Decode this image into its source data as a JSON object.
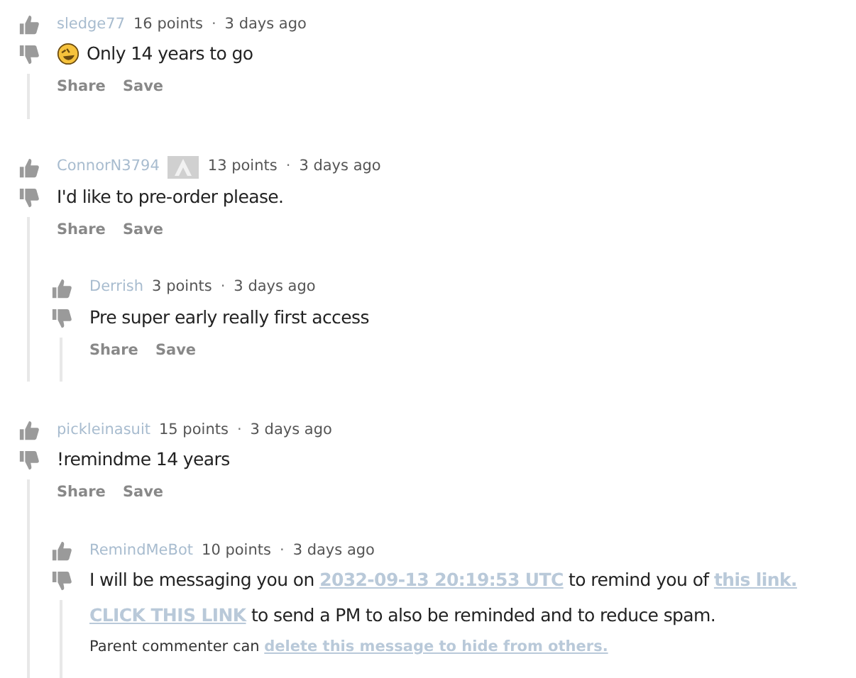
{
  "comments": [
    {
      "author": "sledge77",
      "has_flair": false,
      "points": "16 points",
      "separator": "·",
      "time": "3 days ago",
      "has_emoji": true,
      "body": [
        {
          "kind": "text",
          "segments": [
            {
              "text": "Only 14 years to go",
              "link": false
            }
          ]
        }
      ],
      "actions": [
        "Share",
        "Save"
      ]
    },
    {
      "author": "ConnorN3794",
      "has_flair": true,
      "points": "13 points",
      "separator": "·",
      "time": "3 days ago",
      "has_emoji": false,
      "body": [
        {
          "kind": "text",
          "segments": [
            {
              "text": "I'd like to pre-order please.",
              "link": false
            }
          ]
        }
      ],
      "actions": [
        "Share",
        "Save"
      ],
      "children": [
        {
          "author": "Derrish",
          "has_flair": false,
          "points": "3 points",
          "separator": "·",
          "time": "3 days ago",
          "has_emoji": false,
          "body": [
            {
              "kind": "text",
              "segments": [
                {
                  "text": "Pre super early really first access",
                  "link": false
                }
              ]
            }
          ],
          "actions": [
            "Share",
            "Save"
          ]
        }
      ]
    },
    {
      "author": "pickleinasuit",
      "has_flair": false,
      "points": "15 points",
      "separator": "·",
      "time": "3 days ago",
      "has_emoji": false,
      "body": [
        {
          "kind": "text",
          "segments": [
            {
              "text": "!remindme 14 years",
              "link": false
            }
          ]
        }
      ],
      "actions": [
        "Share",
        "Save"
      ],
      "children": [
        {
          "author": "RemindMeBot",
          "has_flair": false,
          "points": "10 points",
          "separator": "·",
          "time": "3 days ago",
          "has_emoji": false,
          "body": [
            {
              "kind": "text",
              "segments": [
                {
                  "text": "I will be messaging you on ",
                  "link": false
                },
                {
                  "text": "2032-09-13 20:19:53 UTC",
                  "link": true
                },
                {
                  "text": " to remind you of ",
                  "link": false
                },
                {
                  "text": "this link.",
                  "link": true
                }
              ]
            },
            {
              "kind": "text",
              "segments": [
                {
                  "text": "CLICK THIS LINK",
                  "link": true
                },
                {
                  "text": " to send a PM to also be reminded and to reduce spam.",
                  "link": false
                }
              ]
            },
            {
              "kind": "note",
              "segments": [
                {
                  "text": "Parent commenter can ",
                  "link": false
                },
                {
                  "text": "delete this message to hide from others.",
                  "link": true
                }
              ]
            }
          ]
        }
      ]
    }
  ]
}
